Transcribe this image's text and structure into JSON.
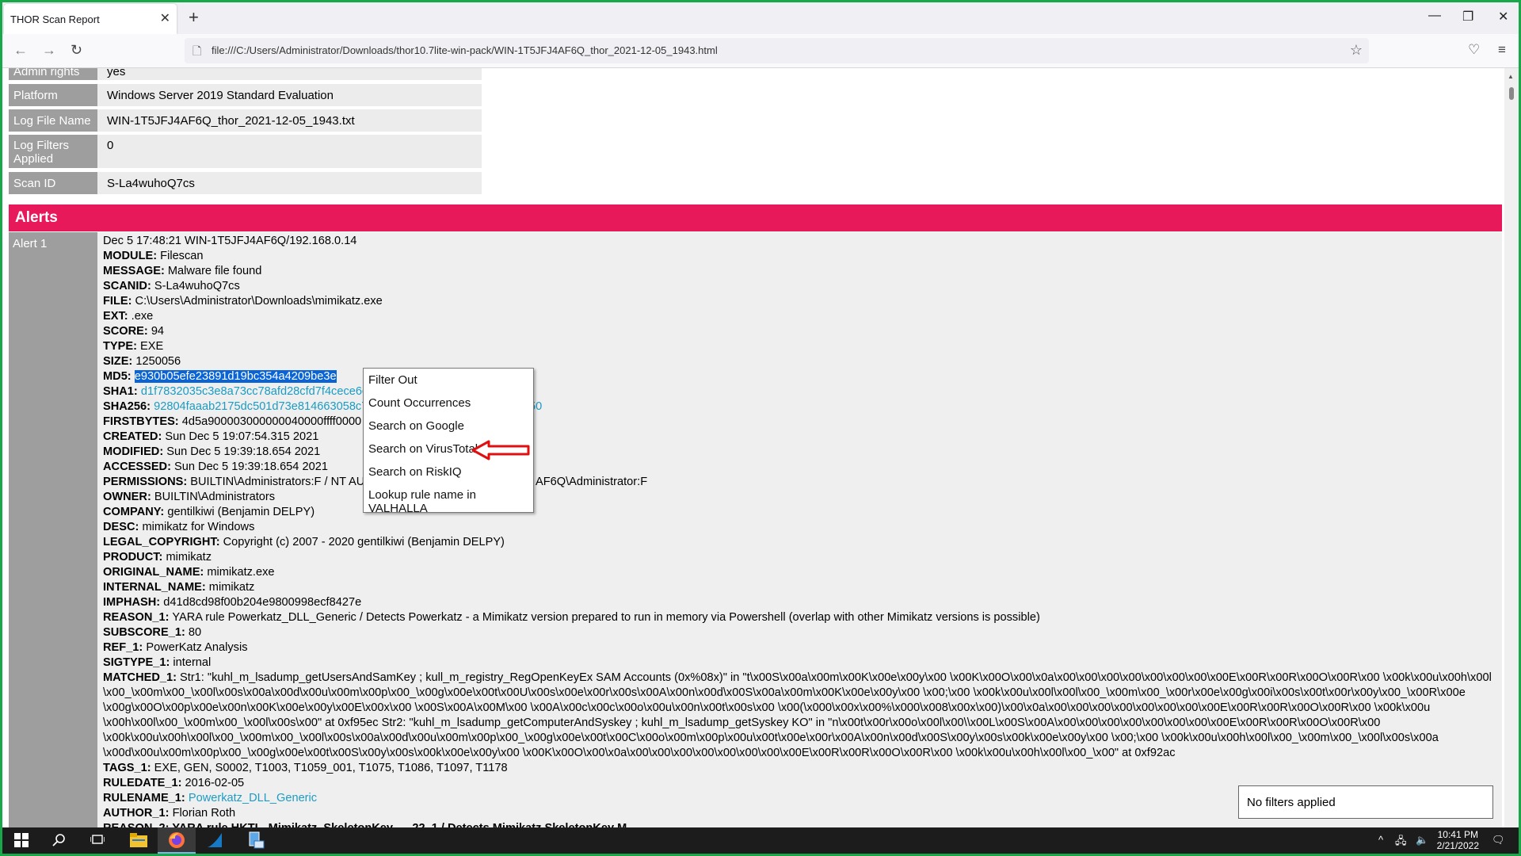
{
  "browser": {
    "tab_title": "THOR Scan Report",
    "tab_close": "✕",
    "new_tab": "+",
    "url": "file:///C:/Users/Administrator/Downloads/thor10.7lite-win-pack/WIN-1T5JFJ4AF6Q_thor_2021-12-05_1943.html",
    "minimize": "—",
    "restore": "❐",
    "close": "✕",
    "back": "←",
    "forward": "→",
    "reload": "↻",
    "page_icon": "🗋",
    "bookmark_star": "☆",
    "pocket_icon": "♡",
    "menu_icon": "≡"
  },
  "info_rows": [
    {
      "label": "Admin rights",
      "value": "yes"
    },
    {
      "label": "Platform",
      "value": "Windows Server 2019 Standard Evaluation"
    },
    {
      "label": "Log File Name",
      "value": "WIN-1T5JFJ4AF6Q_thor_2021-12-05_1943.txt"
    },
    {
      "label": "Log Filters Applied",
      "value": "0"
    },
    {
      "label": "Scan ID",
      "value": "S-La4wuhoQ7cs"
    }
  ],
  "alerts": {
    "header": "Alerts",
    "alert_label": "Alert 1",
    "header_line": "Dec 5 17:48:21 WIN-1T5JFJ4AF6Q/192.168.0.14",
    "fields": [
      {
        "key": "MODULE:",
        "value": " Filescan"
      },
      {
        "key": "MESSAGE:",
        "value": " Malware file found"
      },
      {
        "key": "SCANID:",
        "value": " S-La4wuhoQ7cs"
      },
      {
        "key": "FILE:",
        "value": " C:\\Users\\Administrator\\Downloads\\mimikatz.exe"
      },
      {
        "key": "EXT:",
        "value": " .exe"
      },
      {
        "key": "SCORE:",
        "value": " 94"
      },
      {
        "key": "TYPE:",
        "value": " EXE"
      },
      {
        "key": "SIZE:",
        "value": " 1250056"
      }
    ],
    "md5_key": "MD5:",
    "md5_value": "e930b05efe23891d19bc354a4209be3e",
    "sha1_key": "SHA1:",
    "sha1_value": "d1f7832035c3e8a73cc78afd28cfd7f4cece6d",
    "sha256_key": "SHA256:",
    "sha256_value": "92804faaab2175dc501d73e814663058c7",
    "sha256_tail": "50",
    "fields2": [
      {
        "key": "FIRSTBYTES:",
        "value": " 4d5a900003000000040000ffff0000"
      },
      {
        "key": "CREATED:",
        "value": " Sun Dec 5 19:07:54.315 2021"
      },
      {
        "key": "MODIFIED:",
        "value": " Sun Dec 5 19:39:18.654 2021"
      },
      {
        "key": "ACCESSED:",
        "value": " Sun Dec 5 19:39:18.654 2021"
      }
    ],
    "permissions_key": "PERMISSIONS:",
    "permissions_value": " BUILTIN\\Administrators:F / NT AUTH",
    "permissions_tail": "AF6Q\\Administrator:F",
    "fields3": [
      {
        "key": "OWNER:",
        "value": " BUILTIN\\Administrators"
      },
      {
        "key": "COMPANY:",
        "value": " gentilkiwi (Benjamin DELPY)"
      },
      {
        "key": "DESC:",
        "value": " mimikatz for Windows"
      },
      {
        "key": "LEGAL_COPYRIGHT:",
        "value": " Copyright (c) 2007 - 2020 gentilkiwi (Benjamin DELPY)"
      },
      {
        "key": "PRODUCT:",
        "value": " mimikatz"
      },
      {
        "key": "ORIGINAL_NAME:",
        "value": " mimikatz.exe"
      },
      {
        "key": "INTERNAL_NAME:",
        "value": " mimikatz"
      },
      {
        "key": "IMPHASH:",
        "value": " d41d8cd98f00b204e9800998ecf8427e"
      },
      {
        "key": "REASON_1:",
        "value": " YARA rule Powerkatz_DLL_Generic / Detects Powerkatz - a Mimikatz version prepared to run in memory via Powershell (overlap with other Mimikatz versions is possible)"
      },
      {
        "key": "SUBSCORE_1:",
        "value": " 80"
      },
      {
        "key": "REF_1:",
        "value": " PowerKatz Analysis"
      },
      {
        "key": "SIGTYPE_1:",
        "value": " internal"
      }
    ],
    "matched_key": "MATCHED_1:",
    "matched_lines": [
      " Str1: \"kuhl_m_lsadump_getUsersAndSamKey ; kull_m_registry_RegOpenKeyEx SAM Accounts (0x%08x)\" in \"t\\x00S\\x00a\\x00m\\x00K\\x00e\\x00y\\x00 \\x00K\\x00O\\x00\\x0a\\x00\\x00\\x00\\x00\\x00\\x00\\x00\\x00E\\x00R\\x00R\\x00O\\x00R\\x00 \\x00k\\x00u\\x00h\\x00l",
      "\\x00_\\x00m\\x00_\\x00l\\x00s\\x00a\\x00d\\x00u\\x00m\\x00p\\x00_\\x00g\\x00e\\x00t\\x00U\\x00s\\x00e\\x00r\\x00s\\x00A\\x00n\\x00d\\x00S\\x00a\\x00m\\x00K\\x00e\\x00y\\x00 \\x00;\\x00 \\x00k\\x00u\\x00l\\x00l\\x00_\\x00m\\x00_\\x00r\\x00e\\x00g\\x00i\\x00s\\x00t\\x00r\\x00y\\x00_\\x00R\\x00e",
      "\\x00g\\x00O\\x00p\\x00e\\x00n\\x00K\\x00e\\x00y\\x00E\\x00x\\x00 \\x00S\\x00A\\x00M\\x00 \\x00A\\x00c\\x00c\\x00o\\x00u\\x00n\\x00t\\x00s\\x00 \\x00(\\x000\\x00x\\x00%\\x000\\x008\\x00x\\x00)\\x00\\x0a\\x00\\x00\\x00\\x00\\x00\\x00\\x00\\x00E\\x00R\\x00R\\x00O\\x00R\\x00 \\x00k\\x00u",
      "\\x00h\\x00l\\x00_\\x00m\\x00_\\x00l\\x00s\\x00\" at 0xf95ec Str2: \"kuhl_m_lsadump_getComputerAndSyskey ; kuhl_m_lsadump_getSyskey KO\" in \"n\\x00t\\x00r\\x00o\\x00l\\x00\\\\x00L\\x00S\\x00A\\x00\\x00\\x00\\x00\\x00\\x00\\x00\\x00E\\x00R\\x00R\\x00O\\x00R\\x00",
      "\\x00k\\x00u\\x00h\\x00l\\x00_\\x00m\\x00_\\x00l\\x00s\\x00a\\x00d\\x00u\\x00m\\x00p\\x00_\\x00g\\x00e\\x00t\\x00C\\x00o\\x00m\\x00p\\x00u\\x00t\\x00e\\x00r\\x00A\\x00n\\x00d\\x00S\\x00y\\x00s\\x00k\\x00e\\x00y\\x00 \\x00;\\x00 \\x00k\\x00u\\x00h\\x00l\\x00_\\x00m\\x00_\\x00l\\x00s\\x00a",
      "\\x00d\\x00u\\x00m\\x00p\\x00_\\x00g\\x00e\\x00t\\x00S\\x00y\\x00s\\x00k\\x00e\\x00y\\x00 \\x00K\\x00O\\x00\\x0a\\x00\\x00\\x00\\x00\\x00\\x00\\x00\\x00E\\x00R\\x00R\\x00O\\x00R\\x00 \\x00k\\x00u\\x00h\\x00l\\x00_\\x00\" at 0xf92ac"
    ],
    "fields4": [
      {
        "key": "TAGS_1:",
        "value": " EXE, GEN, S0002, T1003, T1059_001, T1075, T1086, T1097, T1178"
      },
      {
        "key": "RULEDATE_1:",
        "value": " 2016-02-05"
      }
    ],
    "rulename_key": "RULENAME_1:",
    "rulename_value": " Powerkatz_DLL_Generic",
    "author_key": "AUTHOR_1:",
    "author_value": " Florian Roth",
    "reason2_partial": "REASON_2: YARA rule HKTL_Mimikatz_SkeletonKey_... 22_1 / Detects Mimikatz SkeletonKey M..."
  },
  "context_menu": [
    "Filter Out",
    "Count Occurrences",
    "Search on Google",
    "Search on VirusTotal",
    "Search on RiskIQ",
    "Lookup rule name in VALHALLA"
  ],
  "filter_status": "No filters applied",
  "taskbar": {
    "start_icon": "windows-start",
    "time": "10:41 PM",
    "date": "2/21/2022",
    "tray_chevron": "^"
  },
  "colors": {
    "alerts_header": "#e8195a",
    "label_bg": "#9e9e9e",
    "link": "#1b9cc4",
    "selection": "#0a64d6",
    "arrow": "#e01010",
    "frame_border": "#18a84a"
  }
}
